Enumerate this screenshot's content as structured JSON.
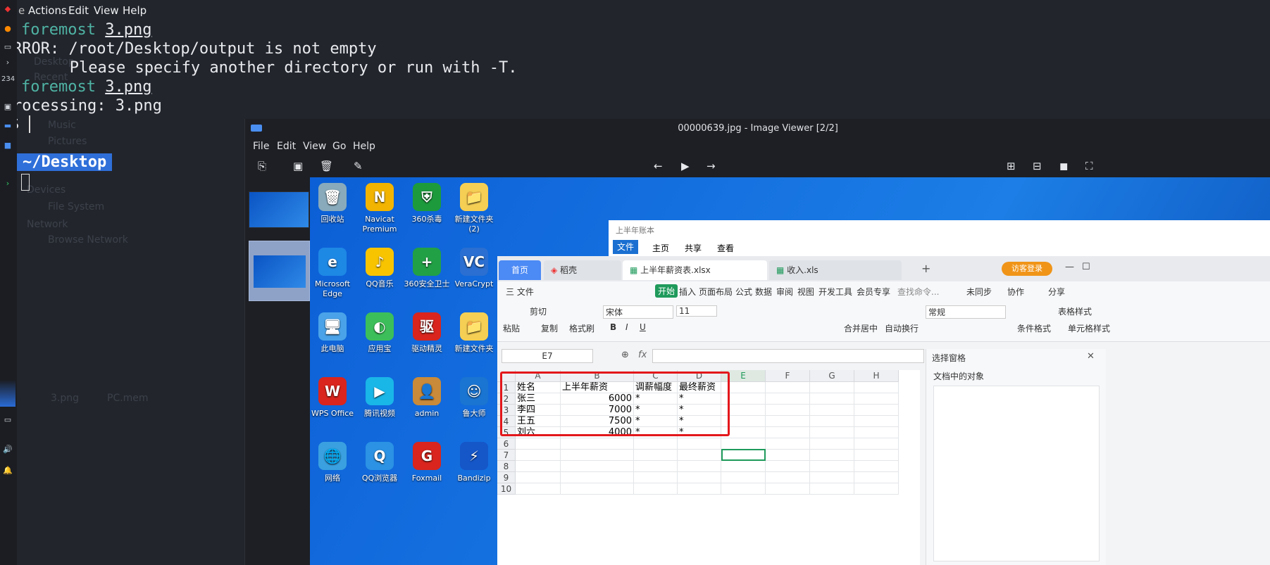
{
  "terminal_menu": {
    "file_partial": "e",
    "items": [
      "Actions",
      "Edit",
      "View",
      "Help"
    ]
  },
  "taskbar": {
    "workspace_numbers": "234",
    "indicator": "4"
  },
  "terminal": {
    "line1_cmd": "foremost",
    "line1_arg": "3.png",
    "line2": "RROR: /root/Desktop/output is not empty",
    "line3": "   Please specify another directory or run with -T.",
    "line4_cmd": "foremost",
    "line4_arg": "3.png",
    "line5": "rocessing: 3.png",
    "line6": "$ ",
    "prompt_dir": "~/Desktop",
    "ghost_items": [
      "Desktop",
      "Recent",
      "Music",
      "Pictures",
      "Devices",
      "File System",
      "Network",
      "Browse Network",
      "3.png",
      "PC.mem"
    ]
  },
  "viewer": {
    "title": "00000639.jpg - Image Viewer [2/2]",
    "menu": [
      "File",
      "Edit",
      "View",
      "Go",
      "Help"
    ],
    "tool_icons": [
      "copy-icon",
      "save-icon",
      "delete-icon",
      "edit-icon",
      "prev-icon",
      "play-icon",
      "next-icon",
      "zoom-in-icon",
      "zoom-out-icon",
      "zoom-fit-icon",
      "fullscreen-icon"
    ]
  },
  "desktop_icons": [
    {
      "label": "回收站",
      "glyph": "🗑"
    },
    {
      "label": "Navicat Premium",
      "glyph": "N"
    },
    {
      "label": "360杀毒",
      "glyph": "⛨"
    },
    {
      "label": "新建文件夹 (2)",
      "glyph": "📁"
    },
    {
      "label": "Microsoft Edge",
      "glyph": "e"
    },
    {
      "label": "QQ音乐",
      "glyph": "♪"
    },
    {
      "label": "360安全卫士",
      "glyph": "+"
    },
    {
      "label": "VeraCrypt",
      "glyph": "VC"
    },
    {
      "label": "此电脑",
      "glyph": "🖥"
    },
    {
      "label": "应用宝",
      "glyph": "◐"
    },
    {
      "label": "驱动精灵",
      "glyph": "驱"
    },
    {
      "label": "新建文件夹",
      "glyph": "📁"
    },
    {
      "label": "WPS Office",
      "glyph": "W"
    },
    {
      "label": "腾讯视频",
      "glyph": "▶"
    },
    {
      "label": "admin",
      "glyph": "👤"
    },
    {
      "label": "鲁大师",
      "glyph": "☺"
    },
    {
      "label": "网络",
      "glyph": "🌐"
    },
    {
      "label": "QQ浏览器",
      "glyph": "Q"
    },
    {
      "label": "Foxmail",
      "glyph": "G"
    },
    {
      "label": "Bandizip",
      "glyph": "⚡"
    }
  ],
  "explorer": {
    "title": "上半年账本",
    "tabs": [
      "文件",
      "主页",
      "共享",
      "查看"
    ]
  },
  "wps": {
    "tabs": [
      "首页",
      "稻壳",
      "上半年薪资表.xlsx",
      "收入.xls"
    ],
    "login": "访客登录",
    "menu": [
      "三 文件",
      "开始",
      "插入",
      "页面布局",
      "公式",
      "数据",
      "审阅",
      "视图",
      "开发工具",
      "会员专享",
      "查找命令...",
      "未同步",
      "协作",
      "分享"
    ],
    "ribbon": [
      "剪切",
      "粘贴",
      "复制",
      "格式刷",
      "宋体",
      "11",
      "合并居中",
      "自动换行",
      "常规",
      "表格样式",
      "条件格式",
      "单元格样式"
    ],
    "cell_ref": "E7",
    "fx": "fx",
    "pane_title": "选择窗格",
    "pane_sub": "文档中的对象",
    "columns": [
      "A",
      "B",
      "C",
      "D",
      "E",
      "F",
      "G",
      "H"
    ],
    "rows": [
      "1",
      "2",
      "3",
      "4",
      "5",
      "6",
      "7",
      "8",
      "9",
      "10"
    ],
    "table": [
      [
        "姓名",
        "上半年薪资",
        "调薪幅度",
        "最终薪资"
      ],
      [
        "张三",
        "6000",
        "*",
        "*"
      ],
      [
        "李四",
        "7000",
        "*",
        "*"
      ],
      [
        "王五",
        "7500",
        "*",
        "*"
      ],
      [
        "刘六",
        "4000",
        "*",
        "*"
      ]
    ]
  }
}
